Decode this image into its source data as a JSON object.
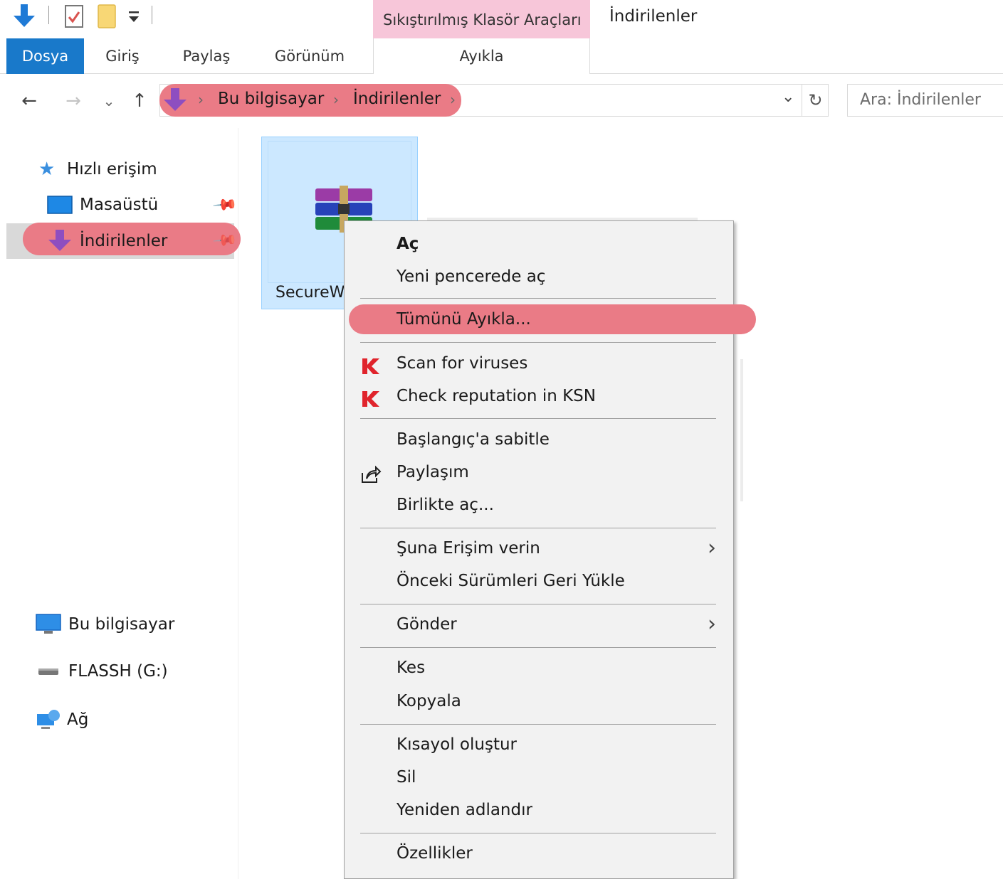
{
  "quick_access": {
    "icons": [
      "download-arrow-icon",
      "properties-check-icon",
      "new-folder-icon",
      "customize-dropdown-icon"
    ]
  },
  "contextual_tab": {
    "header": "Sıkıştırılmış Klasör Araçları"
  },
  "window": {
    "title": "İndirilenler"
  },
  "ribbon": {
    "tabs": [
      "Dosya",
      "Giriş",
      "Paylaş",
      "Görünüm"
    ],
    "contextual_tab_label": "Ayıkla"
  },
  "nav_buttons": {
    "back": "←",
    "forward": "→",
    "recent": "⌄",
    "up": "↑"
  },
  "address": {
    "breadcrumbs": [
      "Bu bilgisayar",
      "İndirilenler"
    ],
    "separator": "›",
    "dropdown": "⌄",
    "refresh": "↻"
  },
  "search": {
    "placeholder": "Ara: İndirilenler"
  },
  "sidebar": {
    "quick_access": {
      "label": "Hızlı erişim",
      "icon": "star-icon"
    },
    "items": [
      {
        "label": "Masaüstü",
        "icon": "desktop-icon",
        "pinned": true
      },
      {
        "label": "İndirilenler",
        "icon": "download-icon",
        "pinned": true,
        "selected": true
      }
    ],
    "this_pc": {
      "label": "Bu bilgisayar",
      "icon": "computer-icon"
    },
    "drive": {
      "label": "FLASSH (G:)",
      "icon": "drive-icon"
    },
    "network": {
      "label": "Ağ",
      "icon": "network-icon"
    }
  },
  "file": {
    "name": "SecureW",
    "icon": "winrar-archive-icon",
    "selected": true
  },
  "context_menu": {
    "items": [
      {
        "label": "Aç",
        "bold": true
      },
      {
        "label": "Yeni pencerede aç"
      },
      {
        "label": "Tümünü Ayıkla...",
        "highlighted": true
      },
      {
        "label": "Scan for viruses",
        "icon": "kaspersky-icon"
      },
      {
        "label": "Check reputation in KSN",
        "icon": "kaspersky-icon"
      },
      {
        "label": "Başlangıç'a sabitle"
      },
      {
        "label": "Paylaşım",
        "icon": "share-icon"
      },
      {
        "label": "Birlikte aç..."
      },
      {
        "label": "Şuna Erişim verin",
        "submenu": true
      },
      {
        "label": "Önceki Sürümleri Geri Yükle"
      },
      {
        "label": "Gönder",
        "submenu": true
      },
      {
        "label": "Kes"
      },
      {
        "label": "Kopyala"
      },
      {
        "label": "Kısayol oluştur"
      },
      {
        "label": "Sil"
      },
      {
        "label": "Yeniden adlandır"
      },
      {
        "label": "Özellikler"
      }
    ],
    "submenu_arrow": "›"
  },
  "colors": {
    "accent": "#1979ca",
    "highlight": "#ea7b86",
    "contextual_tab": "#f7c6d9",
    "selection": "#cce8ff",
    "nav_selection": "#d9d9d9",
    "menu_bg": "#f2f2f2"
  }
}
